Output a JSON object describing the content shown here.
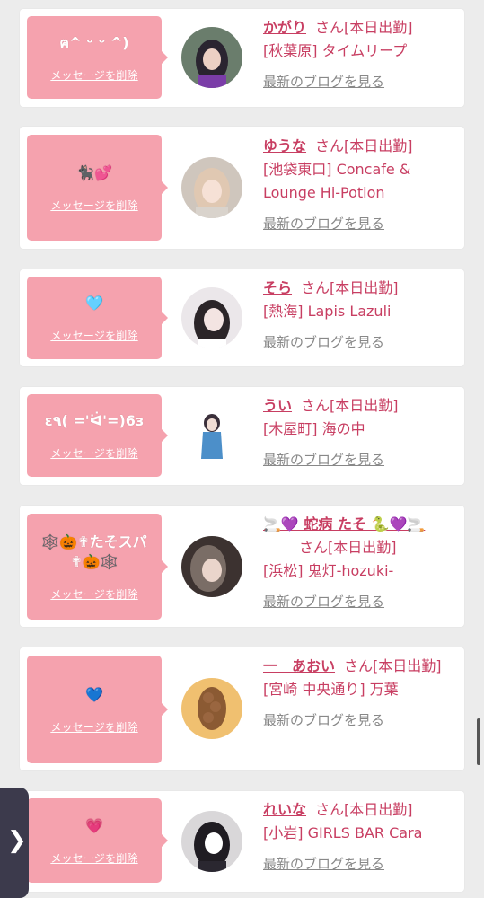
{
  "cards": [
    {
      "message": "ฅ^ ᵕ ᵕ ^)",
      "delete_label": "メッセージを削除",
      "name": "かがり",
      "honorific": "さん[本日出勤]",
      "shop": "[秋葉原] タイムリープ",
      "blog_label": "最新のブログを見る"
    },
    {
      "message": "🐈‍⬛💕",
      "delete_label": "メッセージを削除",
      "name": "ゆうな",
      "honorific": "さん[本日出勤]",
      "shop": "[池袋東口] Concafe & Lounge Hi-Potion",
      "blog_label": "最新のブログを見る"
    },
    {
      "message": "🩵",
      "delete_label": "メッセージを削除",
      "name": "そら",
      "honorific": "さん[本日出勤]",
      "shop": "[熱海] Lapis Lazuli",
      "blog_label": "最新のブログを見る"
    },
    {
      "message": "ε٩( ='ᐛ'=)6з",
      "delete_label": "メッセージを削除",
      "name": "うい",
      "honorific": "さん[本日出勤]",
      "shop": "[木屋町] 海の中",
      "blog_label": "最新のブログを見る"
    },
    {
      "message": "🕸️🎃✟たそスパ✟🎃🕸️",
      "delete_label": "メッセージを削除",
      "name": "🚬💜 蛇病 たそ 🐍💜🚬",
      "honorific": "さん[本日出勤]",
      "shop": "[浜松] 鬼灯-hozuki-",
      "blog_label": "最新のブログを見る"
    },
    {
      "message": "💙",
      "delete_label": "メッセージを削除",
      "name": "一　あおい",
      "honorific": "さん[本日出勤]",
      "shop": "[宮崎 中央通り] 万葉",
      "blog_label": "最新のブログを見る"
    },
    {
      "message": "💗",
      "delete_label": "メッセージを削除",
      "name": "れいな",
      "honorific": "さん[本日出勤]",
      "shop": "[小岩] GIRLS BAR Cara",
      "blog_label": "最新のブログを見る"
    }
  ],
  "side_tab": {
    "icon": "chevron-right-icon",
    "glyph": "❯"
  },
  "colors": {
    "accent": "#c83e62",
    "bubble": "#f5a2ae",
    "background": "#ececec"
  }
}
